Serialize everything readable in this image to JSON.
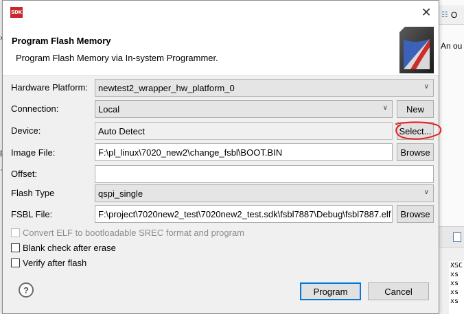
{
  "app_icon_text": "SDK",
  "background": {
    "right_tab_label": "O",
    "right_text": "An ou",
    "bottom_lines": [
      "XSC",
      "xs",
      "xs",
      "xs",
      "xs"
    ]
  },
  "dialog": {
    "close_glyph": "✕",
    "title": "Program Flash Memory",
    "description": "Program Flash Memory via In-system Programmer.",
    "fields": {
      "hardware_platform": {
        "label": "Hardware Platform:",
        "value": "newtest2_wrapper_hw_platform_0"
      },
      "connection": {
        "label": "Connection:",
        "value": "Local",
        "new_button": "New"
      },
      "device": {
        "label": "Device:",
        "value": "Auto Detect",
        "select_button": "Select..."
      },
      "image_file": {
        "label": "Image File:",
        "value": "F:\\pl_linux\\7020_new2\\change_fsbl\\BOOT.BIN",
        "browse_button": "Browse"
      },
      "offset": {
        "label": "Offset:",
        "value": ""
      },
      "flash_type": {
        "label": "Flash Type",
        "value": "qspi_single"
      },
      "fsbl_file": {
        "label": "FSBL File:",
        "value": "F:\\project\\7020new2_test\\7020new2_test.sdk\\fsbl7887\\Debug\\fsbl7887.elf",
        "browse_button": "Browse"
      }
    },
    "options": {
      "convert_elf": "Convert ELF to bootloadable SREC format and program",
      "blank_check": "Blank check after erase",
      "verify": "Verify after flash"
    },
    "help_glyph": "?",
    "program_button": "Program",
    "cancel_button": "Cancel"
  },
  "colors": {
    "annotation_circle": "#e8231c",
    "sdk_icon": "#c9272c",
    "primary_focus": "#0078d7"
  }
}
